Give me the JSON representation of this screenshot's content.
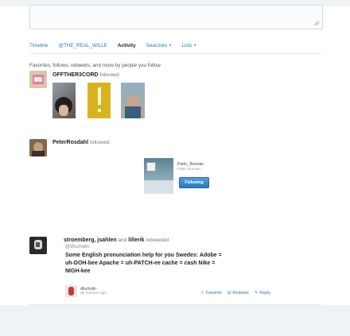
{
  "tabs": [
    {
      "label": "Timeline",
      "active": false
    },
    {
      "label": "@THE_REAL_WILLE",
      "active": false
    },
    {
      "label": "Activity",
      "active": true
    },
    {
      "label": "Searches",
      "active": false,
      "dropdown": true
    },
    {
      "label": "Lists",
      "active": false,
      "dropdown": true
    }
  ],
  "subtitle": "Favorites, follows, retweets, and more by people you follow",
  "activity1": {
    "name": "OFFTHER3CORD",
    "verb": "followed:"
  },
  "activity2": {
    "name": "PeterRosdahl",
    "verb": "followed:",
    "profile_name": "Patric_Broman",
    "profile_handle": "Patric Broman",
    "button_label": "Following"
  },
  "activity3": {
    "names": "stroemberg, jsahlen",
    "conj": "and",
    "last_name": "lillerik",
    "verb": "retweeted",
    "handle": "@dfuchslin:",
    "lines": [
      "Some English pronunciation help for you Swedes: Adobe =",
      "uh-DOH-bee Apache = uh-PATCH-ee cache = cash Nike =",
      "NIGH-kee"
    ],
    "footer_name": "dfuchslin",
    "footer_time": "48 minutes ago",
    "actions": {
      "favorite": "Favorite",
      "retweet": "Retweet",
      "reply": "Reply"
    }
  },
  "colors": {
    "link": "#2b7bb9",
    "follow_button": "#3a8fd6"
  },
  "icons": [
    "resize-handle-icon",
    "caret-down-icon",
    "star-icon",
    "retweet-icon",
    "reply-icon"
  ]
}
